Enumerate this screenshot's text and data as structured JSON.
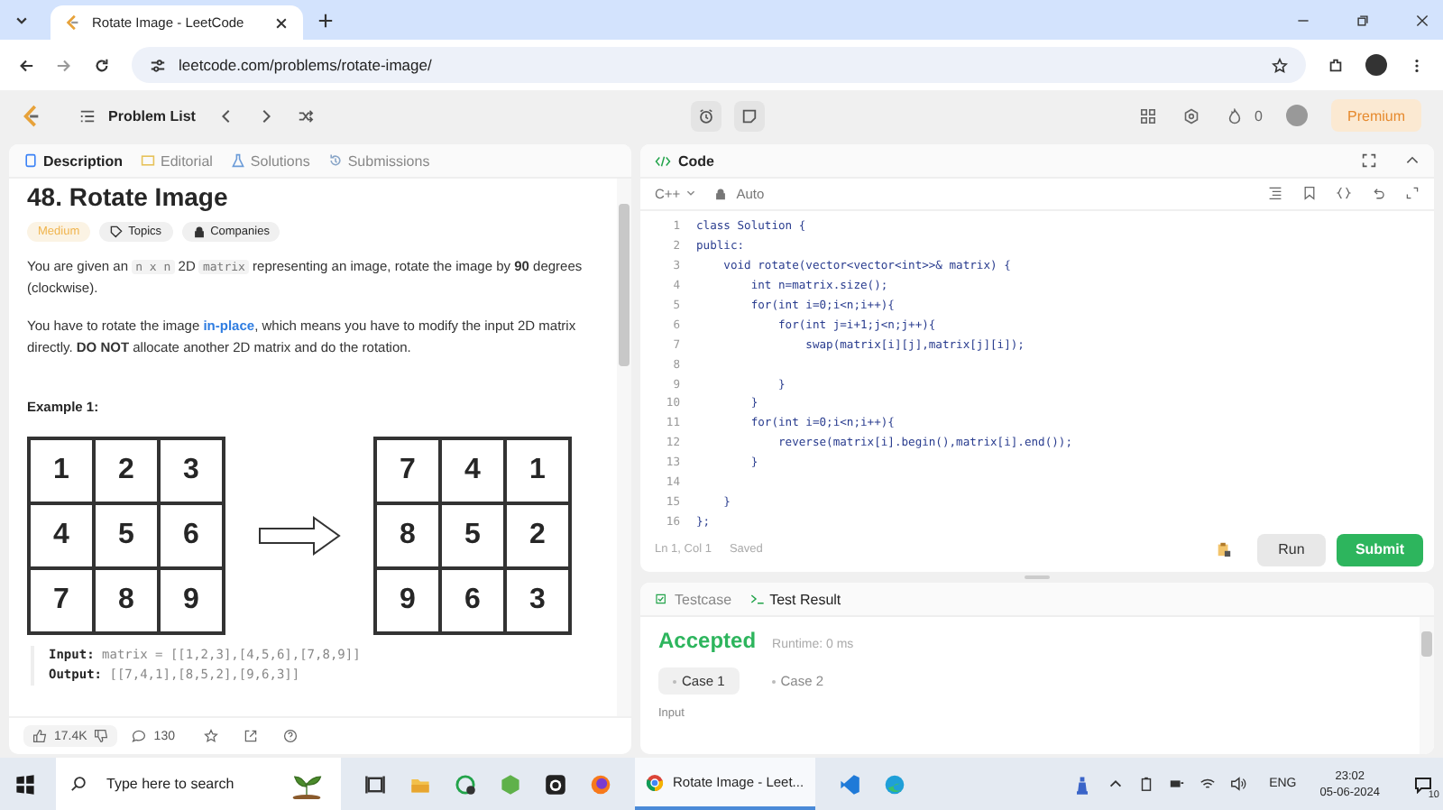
{
  "browser": {
    "tab_title": "Rotate Image - LeetCode",
    "url": "leetcode.com/problems/rotate-image/"
  },
  "nav": {
    "problem_list": "Problem List",
    "streak": "0",
    "premium": "Premium"
  },
  "left_tabs": [
    {
      "label": "Description",
      "selected": true
    },
    {
      "label": "Editorial",
      "selected": false
    },
    {
      "label": "Solutions",
      "selected": false
    },
    {
      "label": "Submissions",
      "selected": false
    }
  ],
  "problem": {
    "title": "48. Rotate Image",
    "difficulty": "Medium",
    "tags": [
      "Topics",
      "Companies"
    ],
    "paragraphs": [
      [
        {
          "kind": "text",
          "text": "You are given an "
        },
        {
          "kind": "code",
          "text": "n x n"
        },
        {
          "kind": "text",
          "text": " 2D "
        },
        {
          "kind": "code",
          "text": "matrix"
        },
        {
          "kind": "text",
          "text": " representing an image, rotate the image by "
        },
        {
          "kind": "bold",
          "text": "90"
        },
        {
          "kind": "text",
          "text": " degrees (clockwise)."
        }
      ],
      [
        {
          "kind": "text",
          "text": "You have to rotate the image "
        },
        {
          "kind": "link",
          "text": "in-place"
        },
        {
          "kind": "text",
          "text": ", which means you have to modify the input 2D matrix directly. "
        },
        {
          "kind": "bold",
          "text": "DO NOT"
        },
        {
          "kind": "text",
          "text": " allocate another 2D matrix and do the rotation."
        }
      ]
    ],
    "example_title": "Example 1:",
    "matrix_before": [
      [
        "1",
        "2",
        "3"
      ],
      [
        "4",
        "5",
        "6"
      ],
      [
        "7",
        "8",
        "9"
      ]
    ],
    "matrix_after": [
      [
        "7",
        "4",
        "1"
      ],
      [
        "8",
        "5",
        "2"
      ],
      [
        "9",
        "6",
        "3"
      ]
    ],
    "example_lines": [
      {
        "label": "Input:",
        "value": "matrix = [[1,2,3],[4,5,6],[7,8,9]]"
      },
      {
        "label": "Output:",
        "value": "[[7,4,1],[8,5,2],[9,6,3]]"
      }
    ]
  },
  "footer": {
    "likes": "17.4K",
    "comments": "130"
  },
  "code_panel": {
    "title": "Code",
    "language": "C++",
    "mode": "Auto",
    "status": "Ln 1, Col 1",
    "saved": "Saved",
    "run": "Run",
    "submit": "Submit",
    "lines": [
      {
        "number": "1",
        "text": "class Solution {"
      },
      {
        "number": "2",
        "text": "public:"
      },
      {
        "number": "3",
        "text": "    void rotate(vector<vector<int>>& matrix) {"
      },
      {
        "number": "4",
        "text": "        int n=matrix.size();"
      },
      {
        "number": "5",
        "text": "        for(int i=0;i<n;i++){"
      },
      {
        "number": "6",
        "text": "            for(int j=i+1;j<n;j++){"
      },
      {
        "number": "7",
        "text": "                swap(matrix[i][j],matrix[j][i]);"
      },
      {
        "number": "8"
      },
      {
        "number": "9",
        "text": "            }"
      },
      {
        "number": "10",
        "text": "        }"
      },
      {
        "number": "11",
        "text": "        for(int i=0;i<n;i++){"
      },
      {
        "number": "12",
        "text": "            reverse(matrix[i].begin(),matrix[i].end());"
      },
      {
        "number": "13",
        "text": "        }"
      },
      {
        "number": "14"
      },
      {
        "number": "15",
        "text": "    }"
      },
      {
        "number": "16",
        "text": "};"
      }
    ]
  },
  "result_tabs": [
    {
      "label": "Testcase",
      "selected": false
    },
    {
      "label": "Test Result",
      "selected": true
    }
  ],
  "result": {
    "verdict": "Accepted",
    "runtime": "Runtime: 0 ms",
    "input_label": "Input",
    "cases": [
      {
        "label": "Case 1",
        "selected": true
      },
      {
        "label": "Case 2",
        "selected": false
      }
    ]
  },
  "taskbar": {
    "search_placeholder": "Type here to search",
    "active_app": "Rotate Image - Leet...",
    "language": "ENG",
    "time": "23:02",
    "date": "05-06-2024",
    "notifications": "10"
  }
}
